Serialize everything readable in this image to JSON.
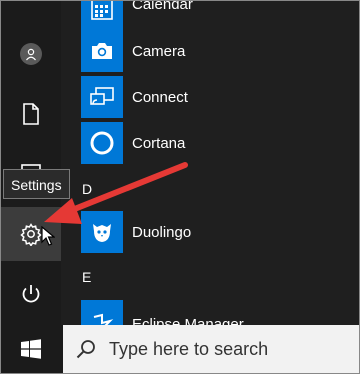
{
  "tooltip": {
    "text": "Settings"
  },
  "app_list": {
    "apps": [
      {
        "label": "Calendar",
        "icon": "calendar-icon"
      },
      {
        "label": "Camera",
        "icon": "camera-icon"
      },
      {
        "label": "Connect",
        "icon": "connect-icon"
      },
      {
        "label": "Cortana",
        "icon": "cortana-icon"
      },
      {
        "label": "Duolingo",
        "icon": "duolingo-icon"
      },
      {
        "label": "Eclipse Manager",
        "icon": "eclipse-manager-icon"
      }
    ],
    "section_letters": [
      "D",
      "E"
    ]
  },
  "rail": {
    "items": [
      {
        "icon": "user-icon"
      },
      {
        "icon": "document-icon"
      },
      {
        "icon": "gear-icon"
      },
      {
        "icon": "power-icon"
      }
    ]
  },
  "taskbar": {
    "start_icon": "windows-logo-icon",
    "search_icon": "search-icon",
    "search_placeholder": "Type here to search"
  },
  "colors": {
    "tile_blue": "#0078d7",
    "arrow_red": "#e53935",
    "background": "#1f1f1f",
    "taskbar": "#1b1b1b"
  }
}
